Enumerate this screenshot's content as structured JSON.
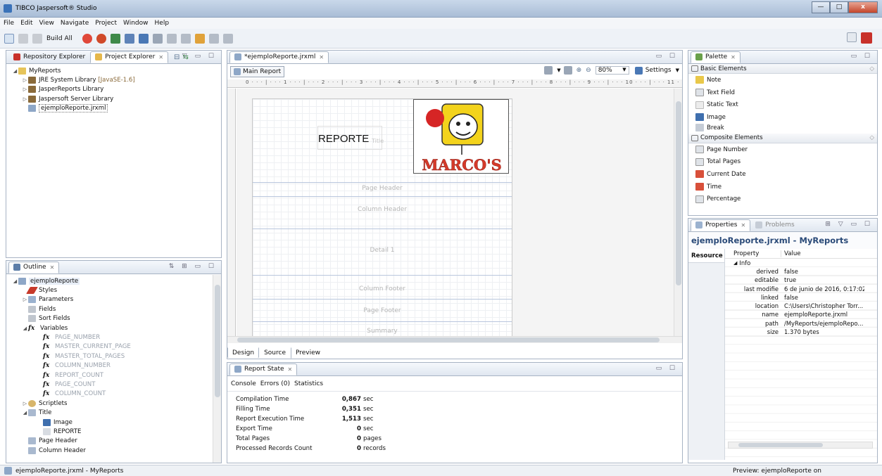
{
  "window": {
    "title": "TIBCO Jaspersoft® Studio",
    "minimize": "—",
    "maximize": "□",
    "close": "x"
  },
  "menu": [
    "File",
    "Edit",
    "View",
    "Navigate",
    "Project",
    "Window",
    "Help"
  ],
  "toolbar": {
    "build_all": "Build All"
  },
  "explorer": {
    "tabs": [
      {
        "label": "Repository Explorer"
      },
      {
        "label": "Project Explorer"
      }
    ],
    "tree": {
      "root": "MyReports",
      "items": [
        {
          "label": "JRE System Library",
          "suffix": "[JavaSE-1.6]"
        },
        {
          "label": "JasperReports Library"
        },
        {
          "label": "Jaspersoft Server Library"
        },
        {
          "label": "ejemploReporte.jrxml"
        }
      ]
    }
  },
  "outline": {
    "tab": "Outline",
    "root": "ejemploReporte",
    "items": [
      {
        "label": "Styles"
      },
      {
        "label": "Parameters"
      },
      {
        "label": "Fields"
      },
      {
        "label": "Sort Fields"
      },
      {
        "label": "Variables"
      }
    ],
    "variables": [
      "PAGE_NUMBER",
      "MASTER_CURRENT_PAGE",
      "MASTER_TOTAL_PAGES",
      "COLUMN_NUMBER",
      "REPORT_COUNT",
      "PAGE_COUNT",
      "COLUMN_COUNT"
    ],
    "after": [
      {
        "label": "Scriptlets"
      },
      {
        "label": "Title"
      },
      {
        "label": "Image"
      },
      {
        "label": "REPORTE"
      },
      {
        "label": "Page Header"
      },
      {
        "label": "Column Header"
      }
    ]
  },
  "editor": {
    "tab": "*ejemploReporte.jrxml",
    "main_report": "Main Report",
    "zoom": "80%",
    "settings": "Settings",
    "ruler": "0 · · · | · · · 1 · · · | · · · 2 · · · | · · · 3 · · · | · · · 4 · · · | · · · 5 · · · | · · · 6 · · · | · · · 7 · · · | · · · 8 · · · | · · · 9 · · · | · · · 10 · · · | · · · 11 · · · | · · · 12 · · · | · · · 13 ·",
    "title_text": "REPORTE",
    "title_band_hint": "Title",
    "logo_text": "MARCO'S",
    "bands": [
      "Page Header",
      "Column Header",
      "Detail 1",
      "Column Footer",
      "Page Footer",
      "Summary"
    ],
    "bottom_tabs": [
      "Design",
      "Source",
      "Preview"
    ]
  },
  "report_state": {
    "tab": "Report State",
    "subtabs": [
      "Console",
      "Errors (0)",
      "Statistics"
    ],
    "rows": [
      {
        "label": "Compilation Time",
        "value": "0,867",
        "unit": "sec"
      },
      {
        "label": "Filling Time",
        "value": "0,351",
        "unit": "sec"
      },
      {
        "label": "Report Execution Time",
        "value": "1,513",
        "unit": "sec"
      },
      {
        "label": "Export Time",
        "value": "0",
        "unit": "sec"
      },
      {
        "label": "Total Pages",
        "value": "0",
        "unit": "pages"
      },
      {
        "label": "Processed Records Count",
        "value": "0",
        "unit": "records"
      }
    ]
  },
  "palette": {
    "tab": "Palette",
    "basic_title": "Basic Elements",
    "basic": [
      "Note",
      "Text Field",
      "Static Text",
      "Image",
      "Break"
    ],
    "composite_title": "Composite Elements",
    "composite": [
      "Page Number",
      "Total Pages",
      "Current Date",
      "Time",
      "Percentage"
    ]
  },
  "properties": {
    "tabs": [
      "Properties",
      "Problems"
    ],
    "header": "ejemploReporte.jrxml - MyReports",
    "side_tab": "Resource",
    "col_property": "Property",
    "col_value": "Value",
    "group": "Info",
    "rows": [
      {
        "k": "derived",
        "v": "false"
      },
      {
        "k": "editable",
        "v": "true"
      },
      {
        "k": "last modifie",
        "v": "6 de junio de 2016, 0:17:02"
      },
      {
        "k": "linked",
        "v": "false"
      },
      {
        "k": "location",
        "v": "C:\\Users\\Christopher Torr..."
      },
      {
        "k": "name",
        "v": "ejemploReporte.jrxml"
      },
      {
        "k": "path",
        "v": "/MyReports/ejemploRepo..."
      },
      {
        "k": "size",
        "v": "1.370  bytes"
      }
    ]
  },
  "status": {
    "left": "ejemploReporte.jrxml - MyReports",
    "right": "Preview: ejemploReporte on"
  }
}
